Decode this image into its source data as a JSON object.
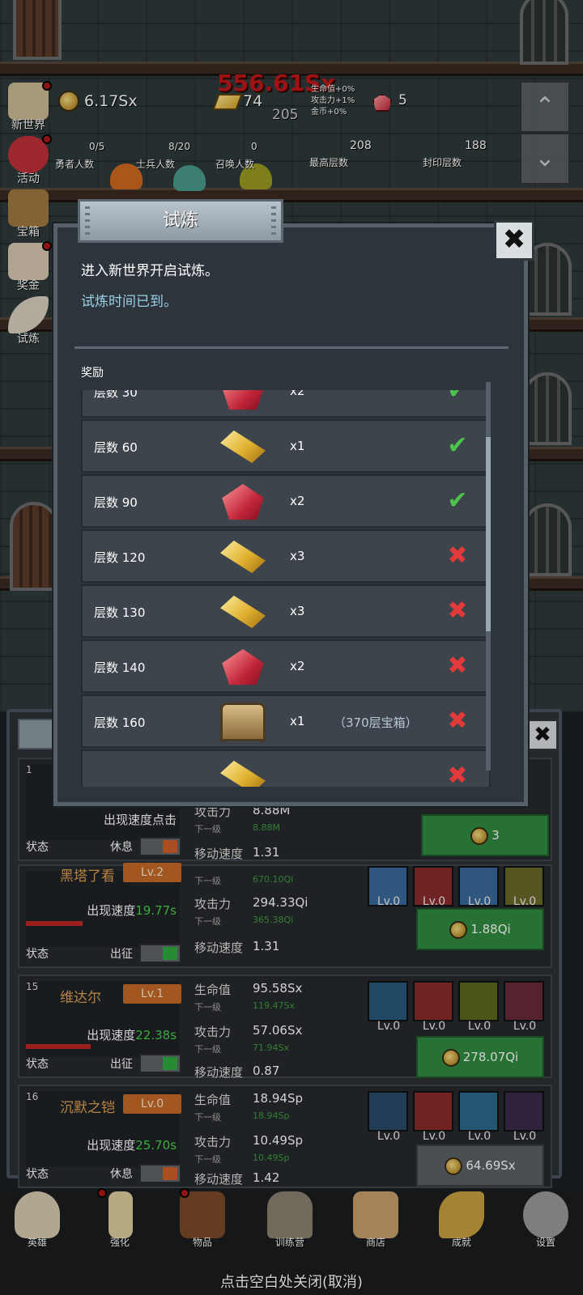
{
  "hud": {
    "coins": "6.17Sx",
    "gold_bars": "74",
    "damage_popup": "556.61Sx",
    "center_number": "205",
    "buffs": [
      "生命值+0%",
      "攻击力+1%",
      "金币+0%"
    ],
    "gems": "5",
    "hero_count_value": "0/5",
    "hero_count_label": "勇者人数",
    "soldier_count_value": "8/20",
    "soldier_count_label": "士兵人数",
    "summon_count_value": "0",
    "summon_count_label": "召唤人数",
    "max_floor_value": "208",
    "max_floor_label": "最高层数",
    "seal_floor_value": "188",
    "seal_floor_label": "封印层数"
  },
  "side_menu": [
    {
      "label": "新世界",
      "icon": "map-icon"
    },
    {
      "label": "活动",
      "icon": "heart-icon"
    },
    {
      "label": "宝箱",
      "icon": "chest-icon"
    },
    {
      "label": "奖金",
      "icon": "envelope-icon"
    },
    {
      "label": "试炼",
      "icon": "feather-icon"
    }
  ],
  "nav_arrows": {
    "up": "⌃",
    "down": "⌄"
  },
  "modal": {
    "title": "试炼",
    "line1": "进入新世界开启试炼。",
    "line2": "试炼时间已到。",
    "rewards_label": "奖励",
    "close_symbol": "✖",
    "rewards": [
      {
        "level": "层数 30",
        "item": "gem",
        "count": "x2",
        "extra": "",
        "done": true,
        "mark": "✔"
      },
      {
        "level": "层数 60",
        "item": "gold-bar",
        "count": "x1",
        "extra": "",
        "done": true,
        "mark": "✔"
      },
      {
        "level": "层数 90",
        "item": "gem",
        "count": "x2",
        "extra": "",
        "done": true,
        "mark": "✔"
      },
      {
        "level": "层数 120",
        "item": "gold-bar",
        "count": "x3",
        "extra": "",
        "done": false,
        "mark": "✖"
      },
      {
        "level": "层数 130",
        "item": "gold-bar",
        "count": "x3",
        "extra": "",
        "done": false,
        "mark": "✖"
      },
      {
        "level": "层数 140",
        "item": "gem",
        "count": "x2",
        "extra": "",
        "done": false,
        "mark": "✖"
      },
      {
        "level": "层数 160",
        "item": "chest",
        "count": "x1",
        "extra": "（370层宝箱）",
        "done": false,
        "mark": "✖"
      },
      {
        "level": "",
        "item": "gold-bar",
        "count": "",
        "extra": "",
        "done": false,
        "mark": "✖"
      }
    ]
  },
  "heroes": {
    "close_symbol": "✖",
    "rows": [
      {
        "num": "1",
        "name": "",
        "lv": "",
        "speed_label": "出现速度点击",
        "speed": "",
        "state_label": "状态",
        "state": "休息",
        "stat1_label": "攻击力",
        "stat1": "8.88M",
        "next_label": "下一级",
        "next1": "8.88M",
        "stat2_label": "",
        "stat2": "",
        "next2": "",
        "move_label": "移动速度",
        "move": "1.31",
        "cost": "3"
      },
      {
        "num": "",
        "name": "黑塔了看",
        "lv": "Lv.2",
        "speed_label": "出现速度",
        "speed": "19.77s",
        "state_label": "状态",
        "state": "出征",
        "stat1_label": "",
        "stat1": "",
        "next_label": "下一级",
        "next1": "670.10Qi",
        "stat2_label": "攻击力",
        "stat2": "294.33Qi",
        "next2": "365.38Qi",
        "move_label": "移动速度",
        "move": "1.31",
        "cost": "1.88Qi",
        "skills": [
          "Lv.0",
          "Lv.0",
          "Lv.0",
          "Lv.0"
        ]
      },
      {
        "num": "15",
        "name": "维达尔",
        "lv": "Lv.1",
        "speed_label": "出现速度",
        "speed": "22.38s",
        "state_label": "状态",
        "state": "出征",
        "stat1_label": "生命值",
        "stat1": "95.58Sx",
        "next_label": "下一级",
        "next1": "119.47Sx",
        "stat2_label": "攻击力",
        "stat2": "57.06Sx",
        "next2": "71.94Sx",
        "move_label": "移动速度",
        "move": "0.87",
        "cost": "278.07Qi",
        "skills": [
          "Lv.0",
          "Lv.0",
          "Lv.0",
          "Lv.0"
        ]
      },
      {
        "num": "16",
        "name": "沉默之铠",
        "lv": "Lv.0",
        "speed_label": "出现速度",
        "speed": "25.70s",
        "state_label": "状态",
        "state": "休息",
        "stat1_label": "生命值",
        "stat1": "18.94Sp",
        "next_label": "下一级",
        "next1": "18.94Sp",
        "stat2_label": "攻击力",
        "stat2": "10.49Sp",
        "next2": "10.49Sp",
        "move_label": "移动速度",
        "move": "1.42",
        "cost": "64.69Sx",
        "skills": [
          "Lv.0",
          "Lv.0",
          "Lv.0",
          "Lv.0"
        ]
      }
    ]
  },
  "bottom_nav": [
    {
      "label": "英雄",
      "icon": "skull-icon"
    },
    {
      "label": "强化",
      "icon": "candle-icon"
    },
    {
      "label": "物品",
      "icon": "book-icon"
    },
    {
      "label": "训练营",
      "icon": "lantern-icon"
    },
    {
      "label": "商店",
      "icon": "mug-icon"
    },
    {
      "label": "成就",
      "icon": "key-icon"
    },
    {
      "label": "设置",
      "icon": "gear-icon"
    }
  ],
  "close_hint": "点击空白处关闭(取消)",
  "colors": {
    "accent_green": "#2f8a3f",
    "level_orange": "#c66a28",
    "check": "#4cc24c",
    "cross": "#e23a3a"
  }
}
